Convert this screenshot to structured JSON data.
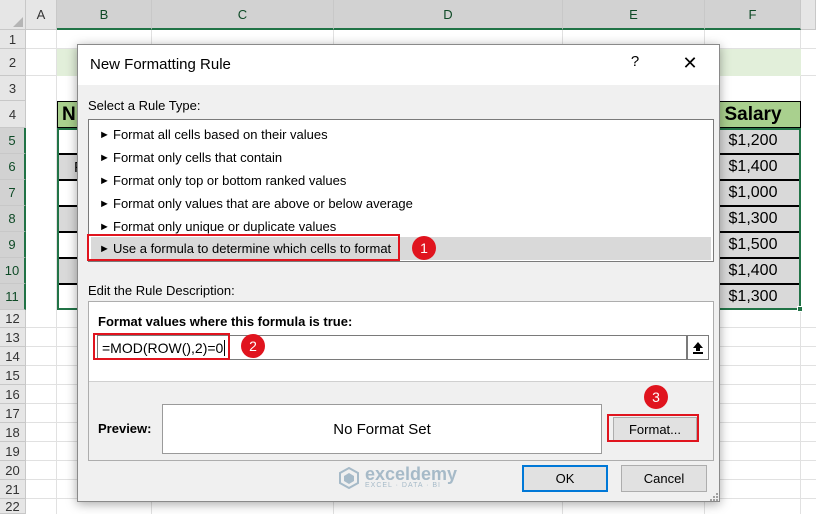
{
  "spreadsheet": {
    "column_headers": [
      "A",
      "B",
      "C",
      "D",
      "E",
      "F"
    ],
    "row_headers": [
      "1",
      "2",
      "3",
      "4",
      "5",
      "6",
      "7",
      "8",
      "9",
      "10",
      "11",
      "12",
      "13",
      "14",
      "15",
      "16",
      "17",
      "18",
      "19",
      "20",
      "21",
      "22"
    ],
    "salary_header": "Salary",
    "partial_header": "N",
    "partial_cell_6": "F",
    "salaries": [
      "$1,200",
      "$1,400",
      "$1,000",
      "$1,300",
      "$1,500",
      "$1,400",
      "$1,300"
    ]
  },
  "dialog": {
    "title": "New Formatting Rule",
    "help": "?",
    "close": "✕",
    "select_rule_type_label": "Select a Rule Type:",
    "rule_types": [
      "Format all cells based on their values",
      "Format only cells that contain",
      "Format only top or bottom ranked values",
      "Format only values that are above or below average",
      "Format only unique or duplicate values",
      "Use a formula to determine which cells to format"
    ],
    "selected_rule_index": 5,
    "edit_rule_label": "Edit the Rule Description:",
    "formula_label": "Format values where this formula is true:",
    "formula_value": "=MOD(ROW(),2)=0",
    "preview_label": "Preview:",
    "preview_text": "No Format Set",
    "format_button": "Format...",
    "ok_button": "OK",
    "cancel_button": "Cancel"
  },
  "annotations": {
    "step1": "1",
    "step2": "2",
    "step3": "3",
    "color": "#e0141e"
  },
  "watermark": {
    "name": "exceldemy",
    "tagline": "EXCEL · DATA · BI"
  },
  "icons": {
    "rule_arrow": "play-arrow-icon",
    "collapse": "upload-arrow-icon",
    "close": "close-icon"
  }
}
